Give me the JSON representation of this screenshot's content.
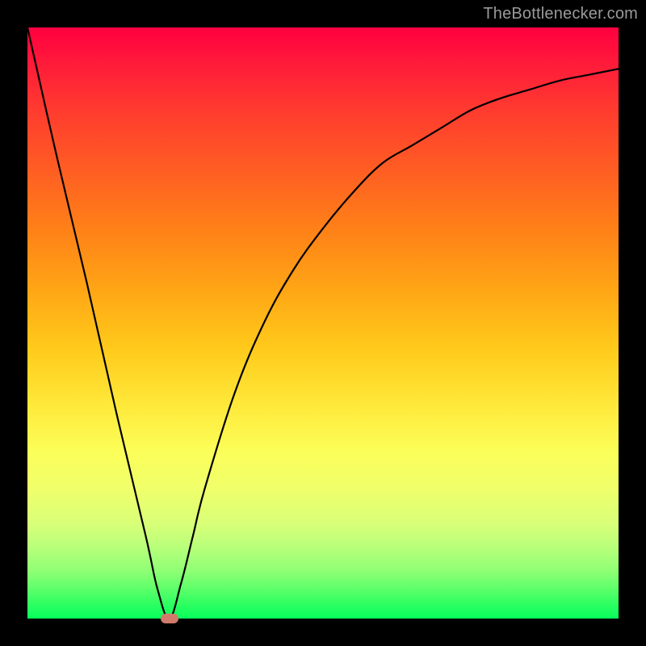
{
  "watermark": {
    "text": "TheBottlenecker.com"
  },
  "chart_data": {
    "type": "line",
    "title": "",
    "xlabel": "",
    "ylabel": "",
    "xlim": [
      0,
      100
    ],
    "ylim": [
      0,
      100
    ],
    "series": [
      {
        "name": "bottleneck-curve",
        "x": [
          0,
          5,
          10,
          15,
          20,
          22,
          24,
          26,
          28,
          30,
          35,
          40,
          45,
          50,
          55,
          60,
          65,
          70,
          75,
          80,
          85,
          90,
          95,
          100
        ],
        "values": [
          100,
          78,
          57,
          35,
          14,
          5,
          0,
          6,
          14,
          22,
          38,
          50,
          59,
          66,
          72,
          77,
          80,
          83,
          86,
          88,
          89.5,
          91,
          92,
          93
        ]
      }
    ],
    "marker": {
      "x": 24,
      "y": 0
    },
    "gradient_colors": {
      "top": "#ff0040",
      "mid1": "#ffa415",
      "mid2": "#fbff5a",
      "bottom": "#07ff5c"
    }
  }
}
